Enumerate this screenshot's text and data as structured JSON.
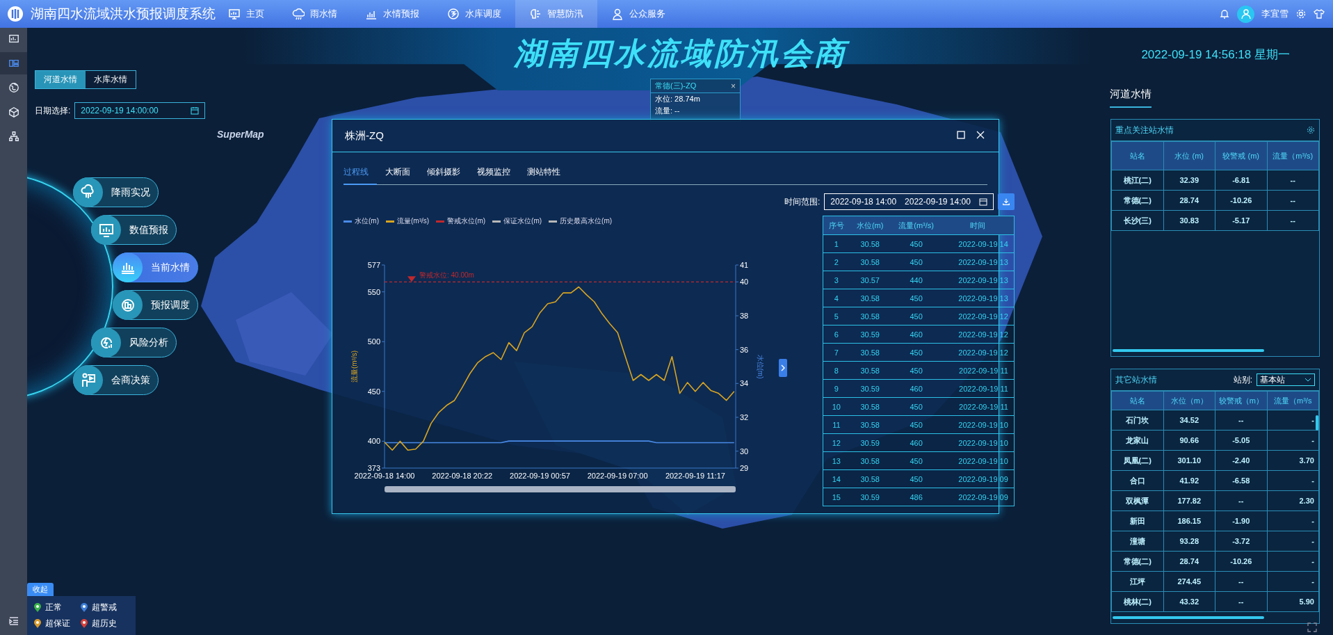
{
  "header": {
    "title": "湖南四水流域洪水预报调度系统",
    "nav": [
      {
        "label": "主页",
        "selected": false
      },
      {
        "label": "雨水情",
        "selected": false
      },
      {
        "label": "水情预报",
        "selected": false
      },
      {
        "label": "水库调度",
        "selected": false
      },
      {
        "label": "智慧防汛",
        "selected": true
      },
      {
        "label": "公众服务",
        "selected": false
      }
    ],
    "user": {
      "name": "李宜雪"
    }
  },
  "rail": [
    {
      "selected": false
    },
    {
      "selected": true
    },
    {
      "selected": false
    },
    {
      "selected": false
    },
    {
      "selected": false
    }
  ],
  "banner": {
    "title": "湖南四水流域防汛会商",
    "datetime": "2022-09-19 14:56:18 星期一"
  },
  "water_tabs": [
    {
      "label": "河道水情",
      "selected": true
    },
    {
      "label": "水库水情",
      "selected": false
    }
  ],
  "date_select": {
    "label": "日期选择:",
    "value": "2022-09-19 14:00:00"
  },
  "map": {
    "logo": "SuperMap",
    "popup": {
      "title": "常德(三)-ZQ",
      "close": "×",
      "lines": [
        "水位: 28.74m",
        "流量: --"
      ]
    }
  },
  "menu": [
    {
      "label": "降雨实况",
      "selected": false
    },
    {
      "label": "数值预报",
      "selected": false
    },
    {
      "label": "当前水情",
      "selected": true
    },
    {
      "label": "预报调度",
      "selected": false
    },
    {
      "label": "风险分析",
      "selected": false
    },
    {
      "label": "会商决策",
      "selected": false
    }
  ],
  "legend": {
    "toggle": "收起",
    "items": [
      {
        "label": "正常",
        "color": "#3cb44a"
      },
      {
        "label": "超警戒",
        "color": "#3f7fd8"
      },
      {
        "label": "超保证",
        "color": "#d89a2c"
      },
      {
        "label": "超历史",
        "color": "#d8403a"
      }
    ]
  },
  "dialog": {
    "title": "株洲-ZQ",
    "tabs": [
      {
        "label": "过程线",
        "selected": true
      },
      {
        "label": "大断面",
        "selected": false
      },
      {
        "label": "倾斜摄影",
        "selected": false
      },
      {
        "label": "视频监控",
        "selected": false
      },
      {
        "label": "测站特性",
        "selected": false
      }
    ],
    "time_range": {
      "label": "时间范围:",
      "start": "2022-09-18 14:00",
      "end": "2022-09-19 14:00"
    },
    "legend": [
      {
        "label": "警戒水位(m)",
        "color": "#c0282d"
      },
      {
        "label": "保证水位(m)",
        "color": "#b8b8b8"
      },
      {
        "label": "历史最高水位(m)",
        "color": "#b8b8b8"
      }
    ],
    "chart_data": {
      "type": "line",
      "ylabel": "流量(m³/s)",
      "y2label": "水位(m)",
      "categories": [
        "2022-09-18 14:00",
        null,
        null,
        null,
        null,
        null,
        null,
        null,
        null,
        null,
        "2022-09-18 20:22",
        null,
        null,
        null,
        null,
        null,
        null,
        null,
        null,
        null,
        "2022-09-19 00:57",
        null,
        null,
        null,
        null,
        null,
        null,
        null,
        null,
        null,
        "2022-09-19 07:00",
        null,
        null,
        null,
        null,
        null,
        null,
        null,
        null,
        null,
        "2022-09-19 11:17",
        null,
        null,
        null,
        null,
        null
      ],
      "ylim": [
        373,
        577
      ],
      "yticks": [
        373,
        400,
        450,
        500,
        550,
        577
      ],
      "y2lim": [
        29,
        41
      ],
      "y2ticks": [
        29,
        30,
        32,
        34,
        36,
        38,
        40,
        41
      ],
      "series": [
        {
          "name": "水位(m)",
          "color": "#4a8ae8",
          "axis": "y2",
          "values": [
            30.5,
            30.5,
            30.5,
            30.5,
            30.5,
            30.5,
            30.5,
            30.5,
            30.5,
            30.5,
            30.5,
            30.5,
            30.5,
            30.5,
            30.5,
            30.5,
            30.6,
            30.6,
            30.6,
            30.6,
            30.6,
            30.6,
            30.6,
            30.6,
            30.6,
            30.6,
            30.6,
            30.6,
            30.6,
            30.6,
            30.6,
            30.6,
            30.6,
            30.6,
            30.6,
            30.5,
            30.5,
            30.5,
            30.5,
            30.5,
            30.5,
            30.5,
            30.5,
            30.5,
            30.5,
            30.5
          ]
        },
        {
          "name": "流量(m³/s)",
          "color": "#d9a520",
          "values": [
            399,
            391,
            400,
            391,
            392,
            400,
            418,
            429,
            436,
            441,
            454,
            468,
            479,
            485,
            489,
            482,
            499,
            491,
            509,
            515,
            529,
            538,
            540,
            549,
            549,
            555,
            547,
            540,
            528,
            518,
            509,
            485,
            461,
            467,
            461,
            467,
            461,
            485,
            448,
            459,
            450,
            459,
            451,
            448,
            441,
            450
          ]
        }
      ],
      "ref_lines": [
        {
          "axis": "y2",
          "value": 40,
          "label": "警戒水位: 40.00m",
          "color": "#c0282d"
        }
      ]
    },
    "table": {
      "columns": [
        "序号",
        "水位(m)",
        "流量(m³/s)",
        "时间"
      ],
      "rows": [
        [
          "1",
          "30.58",
          "450",
          "2022-09-19 14"
        ],
        [
          "2",
          "30.58",
          "450",
          "2022-09-19 13"
        ],
        [
          "3",
          "30.57",
          "440",
          "2022-09-19 13"
        ],
        [
          "4",
          "30.58",
          "450",
          "2022-09-19 13"
        ],
        [
          "5",
          "30.58",
          "450",
          "2022-09-19 12"
        ],
        [
          "6",
          "30.59",
          "460",
          "2022-09-19 12"
        ],
        [
          "7",
          "30.58",
          "450",
          "2022-09-19 12"
        ],
        [
          "8",
          "30.58",
          "450",
          "2022-09-19 11"
        ],
        [
          "9",
          "30.59",
          "460",
          "2022-09-19 11"
        ],
        [
          "10",
          "30.58",
          "450",
          "2022-09-19 11"
        ],
        [
          "11",
          "30.58",
          "450",
          "2022-09-19 10"
        ],
        [
          "12",
          "30.59",
          "460",
          "2022-09-19 10"
        ],
        [
          "13",
          "30.58",
          "450",
          "2022-09-19 10"
        ],
        [
          "14",
          "30.58",
          "450",
          "2022-09-19 09"
        ],
        [
          "15",
          "30.59",
          "486",
          "2022-09-19 09"
        ]
      ]
    }
  },
  "right_panel": {
    "tab": "河道水情",
    "key_stations": {
      "title": "重点关注站水情",
      "columns": [
        "站名",
        "水位 (m)",
        "较警戒 (m)",
        "流量（m³/s)"
      ],
      "rows": [
        [
          "桃江(二)",
          "32.39",
          "-6.81",
          "--"
        ],
        [
          "常德(二)",
          "28.74",
          "-10.26",
          "--"
        ],
        [
          "长沙(三)",
          "30.83",
          "-5.17",
          "--"
        ]
      ]
    },
    "other_stations": {
      "title": "其它站水情",
      "filter_label": "站别:",
      "filter_value": "基本站",
      "columns": [
        "站名",
        "水位（m）",
        "较警戒（m）",
        "流量（m³/s"
      ],
      "rows": [
        [
          "石门坎",
          "34.52",
          "--",
          "-"
        ],
        [
          "龙家山",
          "90.66",
          "-5.05",
          "-"
        ],
        [
          "凤凰(二)",
          "301.10",
          "-2.40",
          "3.70"
        ],
        [
          "合口",
          "41.92",
          "-6.58",
          "-"
        ],
        [
          "双枫潭",
          "177.82",
          "--",
          "2.30"
        ],
        [
          "新田",
          "186.15",
          "-1.90",
          "-"
        ],
        [
          "潼塘",
          "93.28",
          "-3.72",
          "-"
        ],
        [
          "常德(二)",
          "28.74",
          "-10.26",
          "-"
        ],
        [
          "江坪",
          "274.45",
          "--",
          "-"
        ],
        [
          "桃林(二)",
          "43.32",
          "--",
          "5.90"
        ]
      ]
    }
  }
}
